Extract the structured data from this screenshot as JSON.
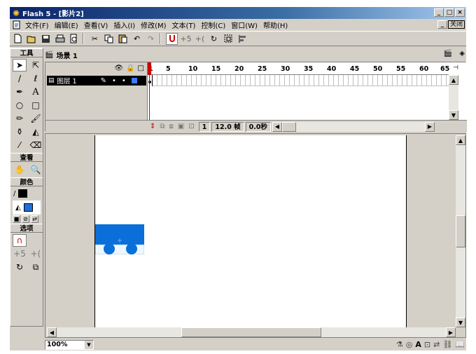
{
  "window": {
    "title": "Flash 5 - [影片2]",
    "min": "_",
    "max": "□",
    "close": "×"
  },
  "menu": {
    "items": [
      "文件(F)",
      "编辑(E)",
      "查看(V)",
      "插入(I)",
      "修改(M)",
      "文本(T)",
      "控制(C)",
      "窗口(W)",
      "帮助(H)"
    ],
    "doc_close": "关闭"
  },
  "toolbar": {
    "buttons": [
      "new-icon",
      "open-icon",
      "save-icon",
      "print-icon",
      "print-preview-icon",
      "cut-icon",
      "copy-icon",
      "paste-icon",
      "undo-icon",
      "redo-icon",
      "magnet-icon",
      "smooth-icon",
      "straighten-icon",
      "rotate-icon",
      "scale-icon",
      "align-icon"
    ]
  },
  "tools_panel": {
    "header": "工具",
    "view_header": "查看",
    "colors_header": "颜色",
    "options_header": "选项",
    "stroke_color": "#000000",
    "fill_color": "#1f6fd6"
  },
  "scene": {
    "label": "场景 1"
  },
  "timeline": {
    "layer_name": "图层 1",
    "ruler_numbers": [
      "1",
      "5",
      "10",
      "15",
      "20",
      "25",
      "30",
      "35",
      "40",
      "45",
      "50",
      "55",
      "60",
      "65"
    ],
    "current_frame": "1",
    "frame_rate": "12.0 帧",
    "elapsed": "0.0秒"
  },
  "stage": {
    "shape_color": "#0a6fd8",
    "wheel_color": "#0a6fd8"
  },
  "status": {
    "zoom": "100%"
  }
}
